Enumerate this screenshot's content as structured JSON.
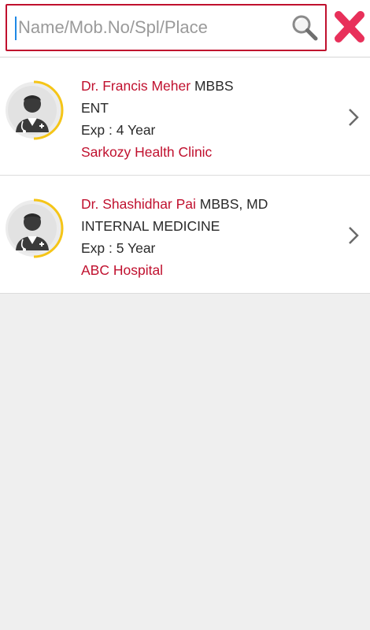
{
  "search": {
    "placeholder": "Name/Mob.No/Spl/Place",
    "value": ""
  },
  "colors": {
    "accent": "#c0102e",
    "close": "#e8305a",
    "ring": "#f5c518"
  },
  "icons": {
    "search": "search-icon",
    "close": "close-icon",
    "avatar": "doctor-avatar-icon",
    "chevron": "chevron-right-icon"
  },
  "doctors": [
    {
      "name": "Dr. Francis Meher",
      "degree": "MBBS",
      "specialty": "ENT",
      "experience": "Exp : 4 Year",
      "clinic": "Sarkozy Health Clinic"
    },
    {
      "name": "Dr. Shashidhar Pai",
      "degree": "MBBS, MD",
      "specialty": "INTERNAL MEDICINE",
      "experience": "Exp : 5 Year",
      "clinic": "ABC Hospital"
    }
  ]
}
